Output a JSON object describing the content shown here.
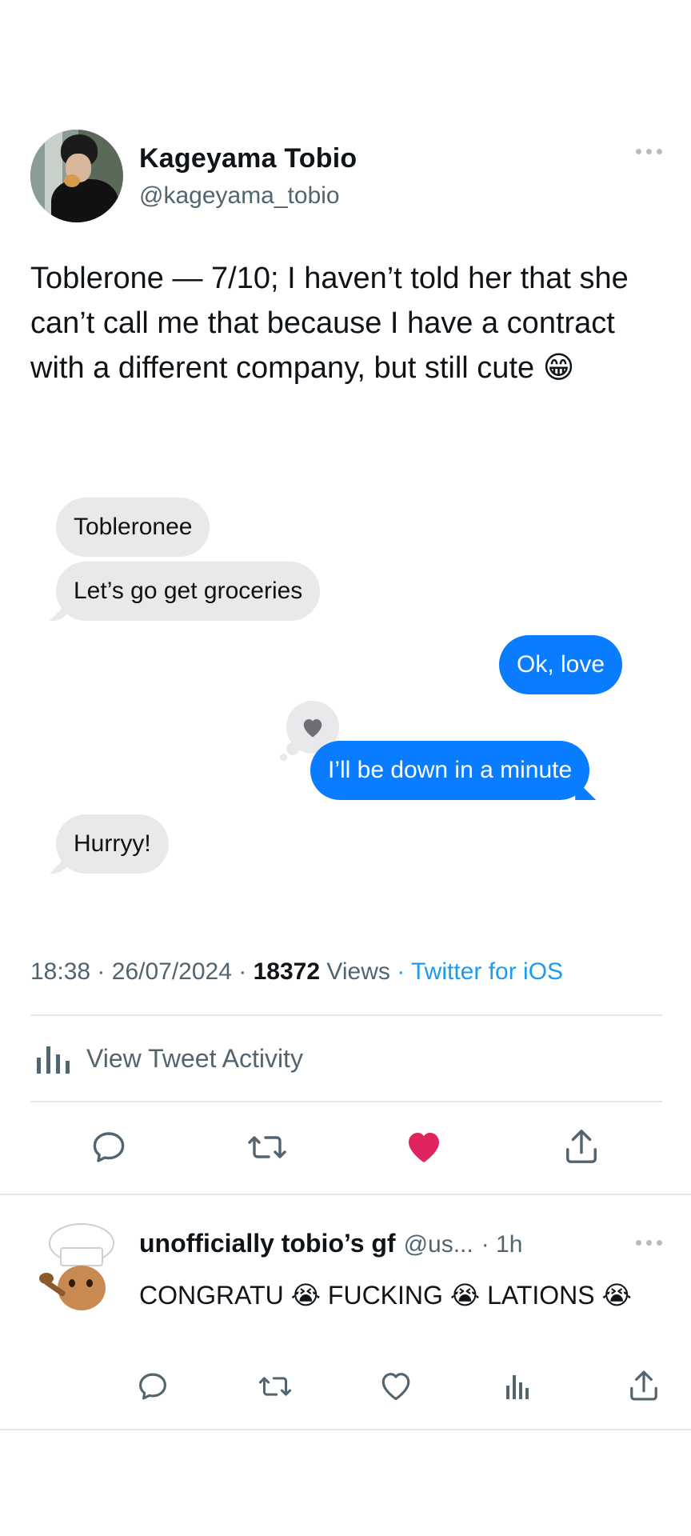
{
  "author": {
    "display_name": "Kageyama Tobio",
    "handle": "@kageyama_tobio"
  },
  "tweet": {
    "text": "Toblerone — 7/10; I haven’t told her that she can’t call me that because I have a contract with a different company, but still cute 😁"
  },
  "chat": {
    "messages": [
      {
        "side": "received",
        "text": "Tobleronee"
      },
      {
        "side": "received",
        "text": "Let’s go get groceries"
      },
      {
        "side": "sent",
        "text": "Ok, love"
      },
      {
        "side": "sent",
        "text": "I’ll be down in a minute",
        "reaction": "heart-icon"
      },
      {
        "side": "received",
        "text": "Hurryy!"
      }
    ],
    "colors": {
      "sent": "#0a7cff",
      "received": "#e9e9eb"
    }
  },
  "meta": {
    "time": "18:38",
    "date": "26/07/2024",
    "views_count": "18372",
    "views_label": "Views",
    "source": "Twitter for iOS",
    "sep": "·"
  },
  "activity": {
    "label": "View Tweet Activity"
  },
  "actions": {
    "liked": true,
    "icons": [
      "reply-icon",
      "retweet-icon",
      "heart-icon",
      "share-icon"
    ],
    "like_color": "#e0245e"
  },
  "reply": {
    "display_name": "unofficially tobio’s gf",
    "handle": "@us...",
    "time": "· 1h",
    "text": "CONGRATU 😭 FUCKING 😭 LATIONS 😭",
    "icons": [
      "reply-icon",
      "retweet-icon",
      "heart-icon",
      "views-icon",
      "share-icon"
    ]
  },
  "colors": {
    "link": "#1d9bf0",
    "secondary_text": "#536471",
    "divider": "#e3e7ea"
  }
}
